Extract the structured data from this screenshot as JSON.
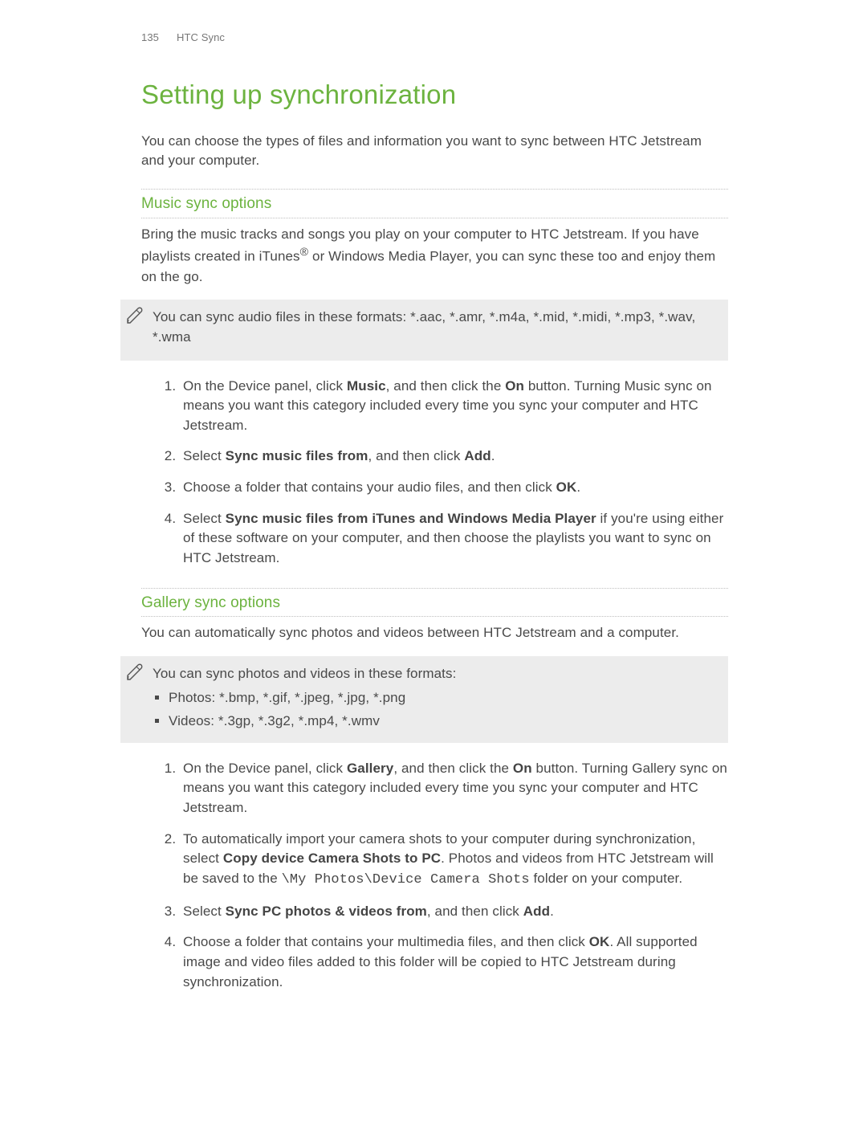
{
  "header": {
    "page_no": "135",
    "section": "HTC Sync"
  },
  "title": "Setting up synchronization",
  "intro": "You can choose the types of files and information you want to sync between HTC Jetstream and your computer.",
  "music": {
    "heading": "Music sync options",
    "intro_html": "Bring the music tracks and songs you play on your computer to HTC Jetstream. If you have playlists created in iTunes<sup>®</sup> or Windows Media Player, you can sync these too and enjoy them on the go.",
    "note": "You can sync audio files in these formats: *.aac, *.amr, *.m4a, *.mid, *.midi, *.mp3, *.wav, *.wma",
    "steps_html": [
      "On the Device panel, click <span class=\"bold\">Music</span>, and then click the <span class=\"bold\">On</span> button. Turning Music sync on means you want this category included every time you sync your computer and HTC Jetstream.",
      "Select <span class=\"bold\">Sync music files from</span>, and then click <span class=\"bold\">Add</span>.",
      "Choose a folder that contains your audio files, and then click <span class=\"bold\">OK</span>.",
      "Select <span class=\"bold\">Sync music files from iTunes and Windows Media Player</span> if you're using either of these software on your computer, and then choose the playlists you want to sync on HTC Jetstream."
    ]
  },
  "gallery": {
    "heading": "Gallery sync options",
    "intro": "You can automatically sync photos and videos between HTC Jetstream and a computer.",
    "note": {
      "lead": "You can sync photos and videos in these formats:",
      "bullets": [
        "Photos: *.bmp, *.gif, *.jpeg, *.jpg, *.png",
        "Videos: *.3gp, *.3g2, *.mp4, *.wmv"
      ]
    },
    "steps_html": [
      "On the Device panel, click <span class=\"bold\">Gallery</span>, and then click the <span class=\"bold\">On</span> button. Turning Gallery sync on means you want this category included every time you sync your computer and HTC Jetstream.",
      "To automatically import your camera shots to your computer during synchronization, select <span class=\"bold\">Copy device Camera Shots to PC</span>. Photos and videos from HTC Jetstream will be saved to the <span class=\"mono\">\\My Photos\\Device Camera Shots</span> folder on your computer.",
      "Select <span class=\"bold\">Sync PC photos & videos from</span>, and then click <span class=\"bold\">Add</span>.",
      "Choose a folder that contains your multimedia files, and then click <span class=\"bold\">OK</span>. All supported image and video files added to this folder will be copied to HTC Jetstream during synchronization."
    ]
  }
}
